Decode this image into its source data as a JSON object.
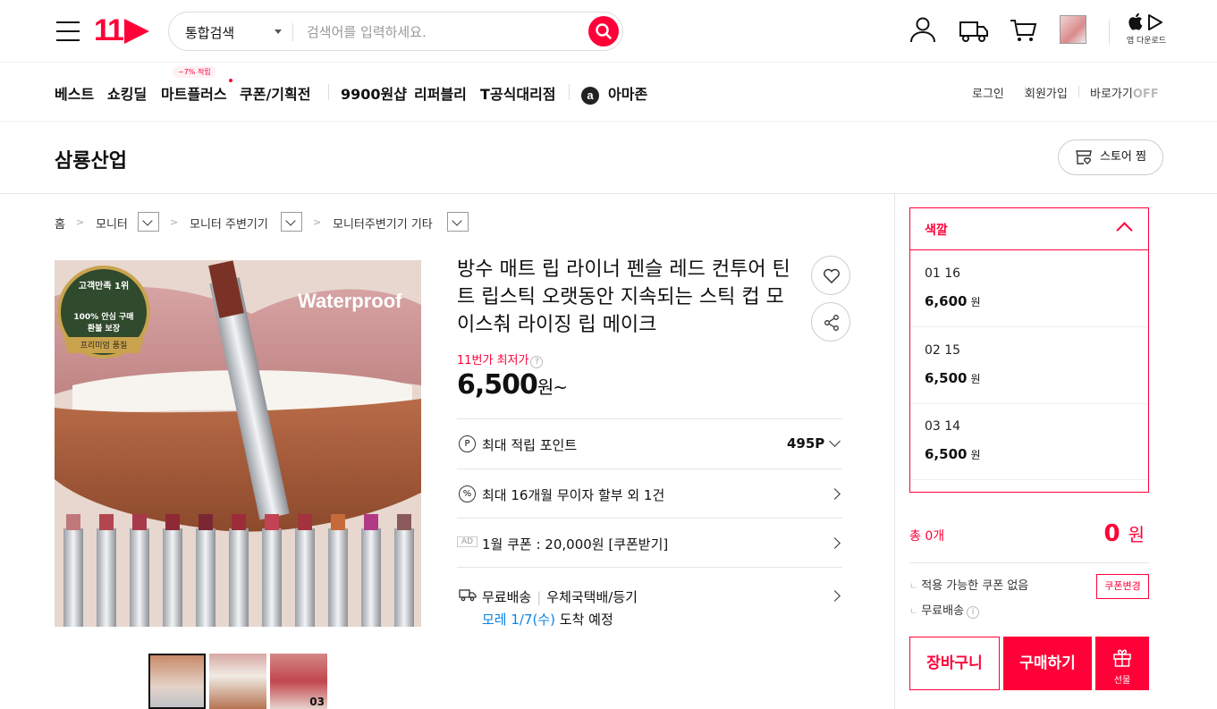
{
  "header": {
    "logo": "11",
    "search": {
      "scope": "통합검색",
      "placeholder": "검색어를 입력하세요."
    },
    "app_download": "앱 다운로드"
  },
  "nav": {
    "items": [
      "베스트",
      "쇼킹딜",
      "마트플러스",
      "쿠폰/기획전",
      "9900원샵",
      "리퍼블리",
      "T공식대리점",
      "아마존"
    ],
    "mart_badge": "~7% 적립",
    "util": {
      "login": "로그인",
      "signup": "회원가입",
      "shortcut": "바로가기",
      "shortcut_state": "OFF"
    }
  },
  "store": {
    "name": "삼룡산업",
    "follow_label": "스토어 찜"
  },
  "breadcrumb": [
    "홈",
    "모니터",
    "모니터 주변기기",
    "모니터주변기기 기타"
  ],
  "product": {
    "image_badge": {
      "top": "고객만족 1위",
      "mid": "100% 안심 구매",
      "mid2": "환불 보장",
      "ribbon": "프리미엄 품질"
    },
    "image_text": "Waterproof",
    "thumb_label": "03",
    "title": "방수 매트 립 라이너 펜슬 레드 컨투어 틴트 립스틱 오랫동안 지속되는 스틱 컵 모이스춰 라이징 립 메이크",
    "lowest_label": "11번가 최저가",
    "price": "6,500",
    "price_suffix": "원~",
    "rows": {
      "points_label": "최대 적립 포인트",
      "points_value": "495P",
      "installment": "최대 16개월 무이자 할부 외 1건",
      "coupon": "1월 쿠폰 : 20,000원 [쿠폰받기]",
      "ad": "AD",
      "shipping": "무료배송",
      "shipping_method": "우체국택배/등기",
      "arrival_date": "모레 1/7(수)",
      "arrival_suffix": "도착 예정"
    }
  },
  "options": {
    "header": "색깔",
    "items": [
      {
        "name": "01 16",
        "price": "6,600"
      },
      {
        "name": "02 15",
        "price": "6,500"
      },
      {
        "name": "03 14",
        "price": "6,500"
      }
    ],
    "won": "원"
  },
  "summary": {
    "total_label": "총 0개",
    "total_value": "0",
    "won": "원",
    "coupon_none": "적용 가능한 쿠폰 없음",
    "coupon_change": "쿠폰변경",
    "free_shipping": "무료배송"
  },
  "actions": {
    "cart": "장바구니",
    "buy": "구매하기",
    "gift": "선물"
  },
  "colors": {
    "brand": "#ff0038",
    "link_blue": "#0b83e6"
  }
}
